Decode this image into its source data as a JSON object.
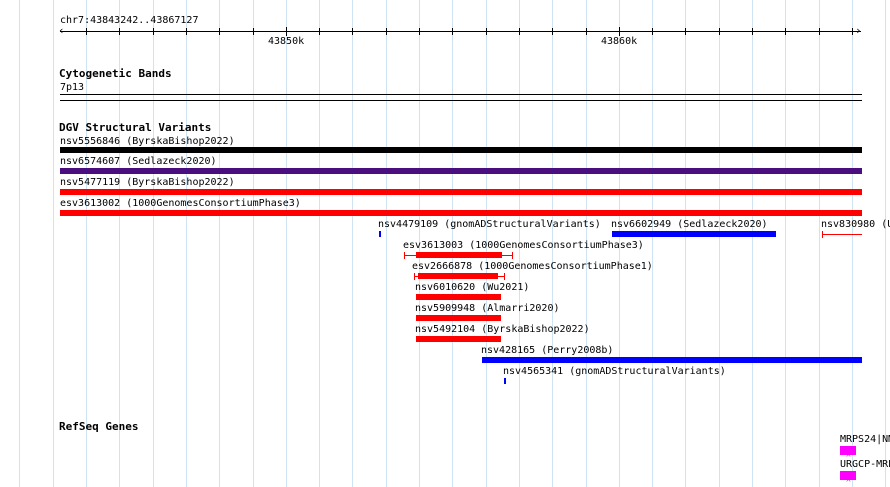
{
  "ruler": {
    "location": "chr7:43843242..43867127",
    "ticks": [
      "43850k",
      "43860k"
    ]
  },
  "tracks": {
    "cytoband": {
      "title": "Cytogenetic Bands",
      "band": "7p13"
    },
    "dgv": {
      "title": "DGV Structural Variants",
      "features": [
        {
          "label": "nsv5556846 (ByrskaBishop2022)",
          "color": "#000000"
        },
        {
          "label": "nsv6574607 (Sedlazeck2020)",
          "color": "#4b0e7e"
        },
        {
          "label": "nsv5477119 (ByrskaBishop2022)",
          "color": "#ff0000"
        },
        {
          "label": "esv3613002 (1000GenomesConsortiumPhase3)",
          "color": "#ff0000"
        },
        {
          "label": "nsv4479109 (gnomADStructuralVariants)",
          "color": "#0000ff"
        },
        {
          "label": "nsv6602949 (Sedlazeck2020)",
          "color": "#0000ff"
        },
        {
          "label": "nsv830980 (U",
          "color": "#ff0000"
        },
        {
          "label": "esv3613003 (1000GenomesConsortiumPhase3)",
          "color": "#ff0000"
        },
        {
          "label": "esv2666878 (1000GenomesConsortiumPhase1)",
          "color": "#ff0000"
        },
        {
          "label": "nsv6010620 (Wu2021)",
          "color": "#ff0000"
        },
        {
          "label": "nsv5909948 (Almarri2020)",
          "color": "#ff0000"
        },
        {
          "label": "nsv5492104 (ByrskaBishop2022)",
          "color": "#ff0000"
        },
        {
          "label": "nsv428165 (Perry2008b)",
          "color": "#0000ff"
        },
        {
          "label": "nsv4565341 (gnomADStructuralVariants)",
          "color": "#0000ff"
        }
      ]
    },
    "refseq": {
      "title": "RefSeq Genes",
      "features": [
        {
          "label": "MRPS24|NM",
          "color": "#ff00ff"
        },
        {
          "label": "URGCP-MRP",
          "color": "#ff00ff"
        }
      ]
    }
  }
}
